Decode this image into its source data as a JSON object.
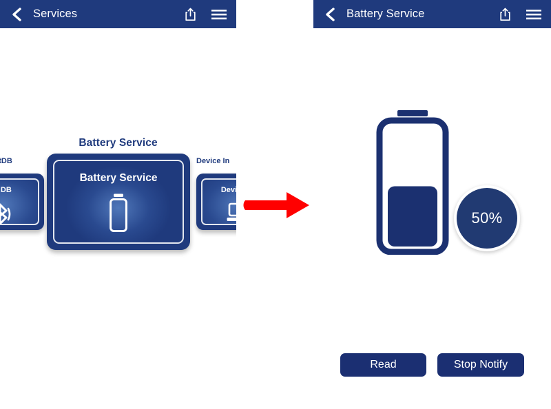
{
  "left_screen": {
    "navbar": {
      "back_icon": "chevron-left-icon",
      "title": "Services",
      "share_icon": "share-icon",
      "menu_icon": "hamburger-menu-icon"
    },
    "carousel": {
      "active_title": "Battery Service",
      "cards": [
        {
          "outer_label": "tDB",
          "inner_label": "T DB",
          "icon": "bluetooth-icon",
          "position": "left-partial"
        },
        {
          "outer_label": "Battery Service",
          "inner_label": "Battery Service",
          "icon": "battery-icon",
          "position": "center-active"
        },
        {
          "outer_label": "Device In",
          "inner_label": "Device In",
          "icon": "device-information-icon",
          "position": "right-partial"
        }
      ]
    }
  },
  "transition": {
    "arrow_icon": "red-right-arrow-icon",
    "color": "#ff0000"
  },
  "right_screen": {
    "navbar": {
      "back_icon": "chevron-left-icon",
      "title": "Battery Service",
      "share_icon": "share-icon",
      "menu_icon": "hamburger-menu-icon"
    },
    "battery": {
      "level_percent": 50,
      "level_label": "50%",
      "icon": "battery-level-icon"
    },
    "buttons": {
      "read": "Read",
      "stop_notify": "Stop Notify"
    }
  },
  "colors": {
    "navy": "#1f3a7d",
    "navy_dark": "#1b2f72",
    "badge_navy": "#213a72",
    "arrow_red": "#ff0000",
    "white": "#ffffff"
  }
}
